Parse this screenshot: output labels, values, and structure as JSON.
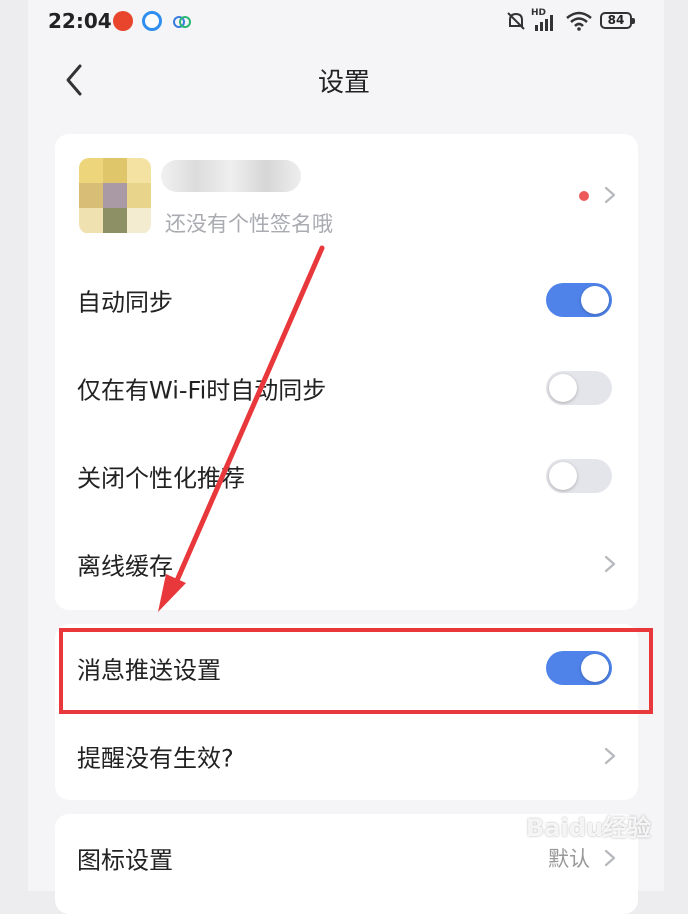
{
  "status_bar": {
    "time": "22:04",
    "battery": "84",
    "network": "HD",
    "icons": [
      "app-icon-red",
      "app-icon-blue",
      "app-icon-cloud",
      "mute-bell-icon",
      "signal-icon",
      "wifi-icon",
      "battery-icon"
    ]
  },
  "header": {
    "title": "设置",
    "back_icon": "chevron-left-icon"
  },
  "profile": {
    "signature": "还没有个性签名哦",
    "has_notification_dot": true
  },
  "settings_main": [
    {
      "label": "自动同步",
      "control": "toggle",
      "on": true
    },
    {
      "label": "仅在有Wi-Fi时自动同步",
      "control": "toggle",
      "on": false
    },
    {
      "label": "关闭个性化推荐",
      "control": "toggle",
      "on": false
    },
    {
      "label": "离线缓存",
      "control": "chevron"
    }
  ],
  "settings_notify": [
    {
      "label": "消息推送设置",
      "control": "toggle",
      "on": true,
      "highlighted": true
    },
    {
      "label": "提醒没有生效?",
      "control": "chevron"
    }
  ],
  "settings_icon": [
    {
      "label": "图标设置",
      "control": "chevron",
      "value": "默认"
    }
  ],
  "colors": {
    "toggle_on": "#4f83ea",
    "toggle_off": "#e4e5ea",
    "highlight_box": "#e8383b",
    "annotation_arrow": "#e8383b"
  },
  "watermark": "Baidu经验"
}
